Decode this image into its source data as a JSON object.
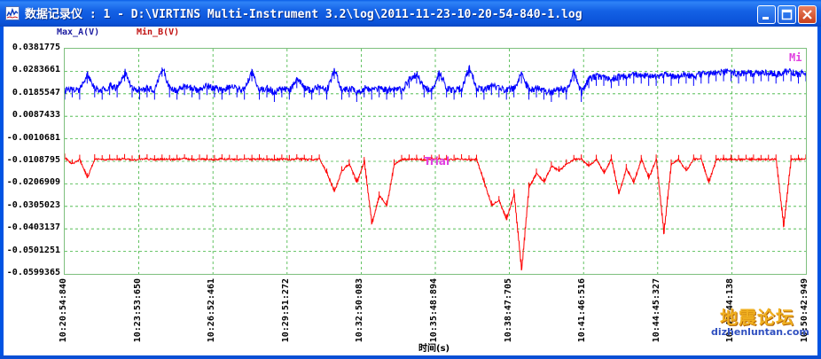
{
  "window": {
    "title": "数据记录仪 : 1 - D:\\VIRTINS Multi-Instrument 3.2\\log\\2011-11-23-10-20-54-840-1.log",
    "icon": "chart-window-icon"
  },
  "chart_data": {
    "type": "line",
    "title": "",
    "xlabel": "时间(s)",
    "ylabel": "",
    "x_tick_labels": [
      "10:20:54:840",
      "10:23:53:650",
      "10:26:52:461",
      "10:29:51:272",
      "10:32:50:083",
      "10:35:48:894",
      "10:38:47:705",
      "10:41:46:516",
      "10:44:45:327",
      "10:47:44:138",
      "10:50:42:949"
    ],
    "y_tick_labels": [
      "0.0381775",
      "0.0283661",
      "0.0185547",
      "0.0087433",
      "-0.0010681",
      "-0.0108795",
      "-0.0206909",
      "-0.0305023",
      "-0.0403137",
      "-0.0501251",
      "-0.0599365"
    ],
    "ylim": [
      -0.0599365,
      0.0381775
    ],
    "grid": true,
    "legend_position": "top-left",
    "series": [
      {
        "name": "Max_A(V)",
        "color": "#0000ff",
        "values": [
          0.02,
          0.021,
          0.02,
          0.027,
          0.021,
          0.02,
          0.022,
          0.021,
          0.028,
          0.021,
          0.02,
          0.021,
          0.02,
          0.03,
          0.021,
          0.02,
          0.022,
          0.021,
          0.02,
          0.022,
          0.021,
          0.02,
          0.022,
          0.021,
          0.02,
          0.028,
          0.02,
          0.021,
          0.019,
          0.021,
          0.02,
          0.025,
          0.021,
          0.02,
          0.022,
          0.02,
          0.029,
          0.02,
          0.021,
          0.019,
          0.021,
          0.02,
          0.021,
          0.02,
          0.021,
          0.02,
          0.025,
          0.027,
          0.021,
          0.02,
          0.028,
          0.021,
          0.02,
          0.021,
          0.03,
          0.021,
          0.02,
          0.022,
          0.021,
          0.02,
          0.021,
          0.027,
          0.02,
          0.021,
          0.02,
          0.019,
          0.021,
          0.02,
          0.028,
          0.019,
          0.025,
          0.026,
          0.026,
          0.025,
          0.026,
          0.026,
          0.027,
          0.027,
          0.026,
          0.026,
          0.027,
          0.026,
          0.027,
          0.027,
          0.026,
          0.027,
          0.027,
          0.028,
          0.028,
          0.028,
          0.027,
          0.028,
          0.027,
          0.028,
          0.028,
          0.027,
          0.028,
          0.028,
          0.027,
          0.028
        ]
      },
      {
        "name": "Min_B(V)",
        "color": "#ff0000",
        "values": [
          -0.0095,
          -0.012,
          -0.01,
          -0.018,
          -0.0098,
          -0.0102,
          -0.0099,
          -0.0101,
          -0.0097,
          -0.0103,
          -0.01,
          -0.0098,
          -0.0102,
          -0.0099,
          -0.0101,
          -0.01,
          -0.0098,
          -0.0102,
          -0.0099,
          -0.01,
          -0.0101,
          -0.0098,
          -0.01,
          -0.0101,
          -0.0099,
          -0.01,
          -0.0098,
          -0.0102,
          -0.01,
          -0.0099,
          -0.0101,
          -0.0098,
          -0.01,
          -0.0102,
          -0.0099,
          -0.016,
          -0.024,
          -0.015,
          -0.012,
          -0.02,
          -0.011,
          -0.038,
          -0.026,
          -0.03,
          -0.012,
          -0.0101,
          -0.0099,
          -0.01,
          -0.0102,
          -0.01,
          -0.0099,
          -0.0101,
          -0.01,
          -0.0098,
          -0.0102,
          -0.01,
          -0.02,
          -0.03,
          -0.028,
          -0.036,
          -0.025,
          -0.058,
          -0.022,
          -0.016,
          -0.02,
          -0.013,
          -0.015,
          -0.012,
          -0.0101,
          -0.0099,
          -0.013,
          -0.01,
          -0.016,
          -0.0099,
          -0.025,
          -0.014,
          -0.02,
          -0.0101,
          -0.018,
          -0.0099,
          -0.042,
          -0.012,
          -0.0101,
          -0.015,
          -0.0099,
          -0.01,
          -0.02,
          -0.0101,
          -0.01,
          -0.0099,
          -0.0101,
          -0.01,
          -0.0099,
          -0.0101,
          -0.01,
          -0.0099,
          -0.039,
          -0.0101,
          -0.01,
          -0.0099
        ]
      }
    ],
    "annotations": [
      "Mi",
      "Trial"
    ]
  },
  "watermark": {
    "cn": "地震论坛",
    "url": "dizhenluntan.com"
  }
}
